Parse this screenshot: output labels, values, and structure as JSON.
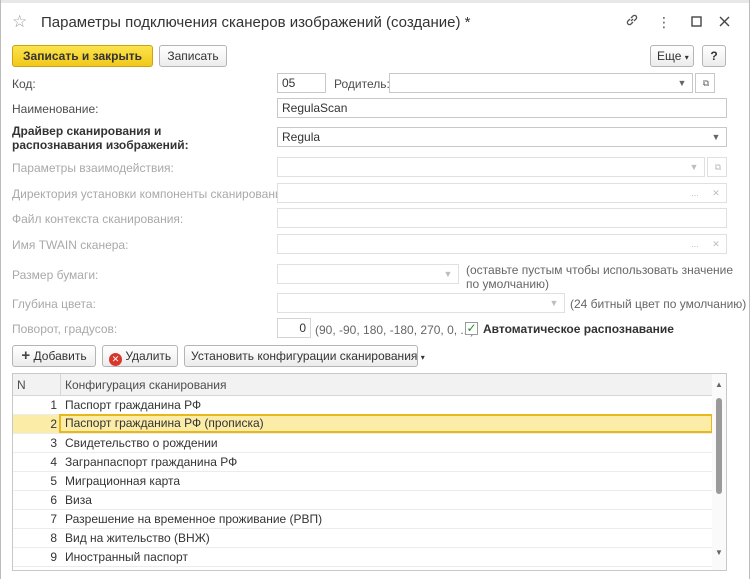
{
  "window": {
    "title": "Параметры подключения сканеров изображений (создание) *"
  },
  "toolbar": {
    "save_close_label": "Записать и закрыть",
    "save_label": "Записать",
    "more_label": "Еще",
    "help_label": "?"
  },
  "form": {
    "code_label": "Код:",
    "code_value": "05",
    "parent_label": "Родитель:",
    "parent_value": "",
    "name_label": "Наименование:",
    "name_value": "RegulaScan",
    "driver_label_1": "Драйвер сканирования и",
    "driver_label_2": "распознавания изображений:",
    "driver_value": "Regula",
    "interaction_label": "Параметры взаимодействия:",
    "install_dir_label": "Директория установки компоненты сканирования:",
    "context_file_label": "Файл контекста сканирования:",
    "twain_label": "Имя TWAIN сканера:",
    "paper_label": "Размер бумаги:",
    "paper_note": "(оставьте пустым чтобы использовать значение по умолчанию)",
    "color_depth_label": "Глубина цвета:",
    "color_depth_note": "(24 битный цвет по умолчанию)",
    "rotation_label": "Поворот, градусов:",
    "rotation_value": "0",
    "rotation_note": "(90, -90, 180, -180, 270, 0, ...)",
    "auto_recognition_label": "Автоматическое распознавание",
    "auto_recognition_checked": true
  },
  "table_toolbar": {
    "add_label": "Добавить",
    "delete_label": "Удалить",
    "set_config_label": "Установить конфигурации сканирования"
  },
  "table": {
    "col_n": "N",
    "col_config": "Конфигурация сканирования",
    "rows": [
      {
        "n": "1",
        "config": "Паспорт гражданина РФ"
      },
      {
        "n": "2",
        "config": "Паспорт гражданина РФ (прописка)"
      },
      {
        "n": "3",
        "config": "Свидетельство о рождении"
      },
      {
        "n": "4",
        "config": "Загранпаспорт гражданина РФ"
      },
      {
        "n": "5",
        "config": "Миграционная карта"
      },
      {
        "n": "6",
        "config": "Виза"
      },
      {
        "n": "7",
        "config": "Разрешение на временное проживание (РВП)"
      },
      {
        "n": "8",
        "config": "Вид на жительство (ВНЖ)"
      },
      {
        "n": "9",
        "config": "Иностранный паспорт"
      }
    ],
    "selected_row": 2
  },
  "colors": {
    "primary_button": "#f1c81a",
    "selected_row": "#fbeca8",
    "selected_outline": "#e8b81a",
    "delete_icon": "#d9362b",
    "check_mark": "#2b8a2b"
  }
}
